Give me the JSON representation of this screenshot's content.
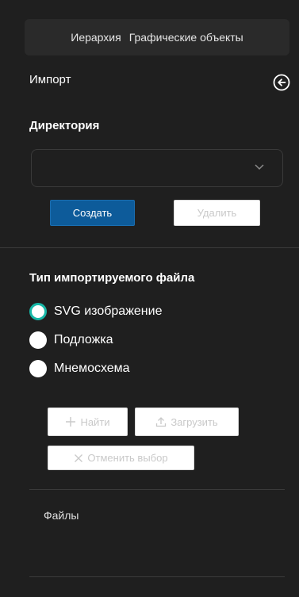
{
  "tabs": [
    {
      "label": "Иерархия"
    },
    {
      "label": "Графические объекты"
    }
  ],
  "import": {
    "title": "Импорт",
    "directory_label": "Директория",
    "directory_value": "",
    "create_label": "Создать",
    "delete_label": "Удалить"
  },
  "filetype": {
    "title": "Тип импортируемого файла",
    "options": [
      {
        "label": "SVG изображение",
        "selected": true
      },
      {
        "label": "Подложка",
        "selected": false
      },
      {
        "label": "Мнемосхема",
        "selected": false
      }
    ],
    "find_label": "Найти",
    "upload_label": "Загрузить",
    "cancel_label": "Отменить выбор"
  },
  "files": {
    "label": "Файлы"
  },
  "icons": [
    "back-arrow-icon",
    "chevron-down-icon",
    "plus-icon",
    "upload-icon",
    "close-icon"
  ],
  "colors": {
    "accent": "#0d5b9a",
    "radio_selected": "#17b7a7",
    "background": "#1f1f1f"
  }
}
